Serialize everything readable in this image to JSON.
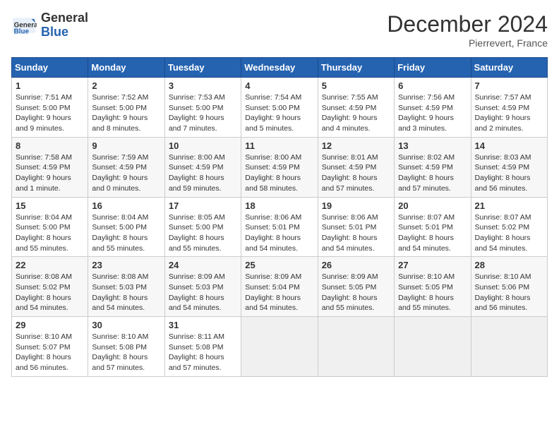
{
  "header": {
    "logo_line1": "General",
    "logo_line2": "Blue",
    "month": "December 2024",
    "location": "Pierrevert, France"
  },
  "weekdays": [
    "Sunday",
    "Monday",
    "Tuesday",
    "Wednesday",
    "Thursday",
    "Friday",
    "Saturday"
  ],
  "weeks": [
    [
      {
        "day": 1,
        "sunrise": "7:51 AM",
        "sunset": "5:00 PM",
        "daylight": "9 hours and 9 minutes."
      },
      {
        "day": 2,
        "sunrise": "7:52 AM",
        "sunset": "5:00 PM",
        "daylight": "9 hours and 8 minutes."
      },
      {
        "day": 3,
        "sunrise": "7:53 AM",
        "sunset": "5:00 PM",
        "daylight": "9 hours and 7 minutes."
      },
      {
        "day": 4,
        "sunrise": "7:54 AM",
        "sunset": "5:00 PM",
        "daylight": "9 hours and 5 minutes."
      },
      {
        "day": 5,
        "sunrise": "7:55 AM",
        "sunset": "4:59 PM",
        "daylight": "9 hours and 4 minutes."
      },
      {
        "day": 6,
        "sunrise": "7:56 AM",
        "sunset": "4:59 PM",
        "daylight": "9 hours and 3 minutes."
      },
      {
        "day": 7,
        "sunrise": "7:57 AM",
        "sunset": "4:59 PM",
        "daylight": "9 hours and 2 minutes."
      }
    ],
    [
      {
        "day": 8,
        "sunrise": "7:58 AM",
        "sunset": "4:59 PM",
        "daylight": "9 hours and 1 minute."
      },
      {
        "day": 9,
        "sunrise": "7:59 AM",
        "sunset": "4:59 PM",
        "daylight": "9 hours and 0 minutes."
      },
      {
        "day": 10,
        "sunrise": "8:00 AM",
        "sunset": "4:59 PM",
        "daylight": "8 hours and 59 minutes."
      },
      {
        "day": 11,
        "sunrise": "8:00 AM",
        "sunset": "4:59 PM",
        "daylight": "8 hours and 58 minutes."
      },
      {
        "day": 12,
        "sunrise": "8:01 AM",
        "sunset": "4:59 PM",
        "daylight": "8 hours and 57 minutes."
      },
      {
        "day": 13,
        "sunrise": "8:02 AM",
        "sunset": "4:59 PM",
        "daylight": "8 hours and 57 minutes."
      },
      {
        "day": 14,
        "sunrise": "8:03 AM",
        "sunset": "4:59 PM",
        "daylight": "8 hours and 56 minutes."
      }
    ],
    [
      {
        "day": 15,
        "sunrise": "8:04 AM",
        "sunset": "5:00 PM",
        "daylight": "8 hours and 55 minutes."
      },
      {
        "day": 16,
        "sunrise": "8:04 AM",
        "sunset": "5:00 PM",
        "daylight": "8 hours and 55 minutes."
      },
      {
        "day": 17,
        "sunrise": "8:05 AM",
        "sunset": "5:00 PM",
        "daylight": "8 hours and 55 minutes."
      },
      {
        "day": 18,
        "sunrise": "8:06 AM",
        "sunset": "5:01 PM",
        "daylight": "8 hours and 54 minutes."
      },
      {
        "day": 19,
        "sunrise": "8:06 AM",
        "sunset": "5:01 PM",
        "daylight": "8 hours and 54 minutes."
      },
      {
        "day": 20,
        "sunrise": "8:07 AM",
        "sunset": "5:01 PM",
        "daylight": "8 hours and 54 minutes."
      },
      {
        "day": 21,
        "sunrise": "8:07 AM",
        "sunset": "5:02 PM",
        "daylight": "8 hours and 54 minutes."
      }
    ],
    [
      {
        "day": 22,
        "sunrise": "8:08 AM",
        "sunset": "5:02 PM",
        "daylight": "8 hours and 54 minutes."
      },
      {
        "day": 23,
        "sunrise": "8:08 AM",
        "sunset": "5:03 PM",
        "daylight": "8 hours and 54 minutes."
      },
      {
        "day": 24,
        "sunrise": "8:09 AM",
        "sunset": "5:03 PM",
        "daylight": "8 hours and 54 minutes."
      },
      {
        "day": 25,
        "sunrise": "8:09 AM",
        "sunset": "5:04 PM",
        "daylight": "8 hours and 54 minutes."
      },
      {
        "day": 26,
        "sunrise": "8:09 AM",
        "sunset": "5:05 PM",
        "daylight": "8 hours and 55 minutes."
      },
      {
        "day": 27,
        "sunrise": "8:10 AM",
        "sunset": "5:05 PM",
        "daylight": "8 hours and 55 minutes."
      },
      {
        "day": 28,
        "sunrise": "8:10 AM",
        "sunset": "5:06 PM",
        "daylight": "8 hours and 56 minutes."
      }
    ],
    [
      {
        "day": 29,
        "sunrise": "8:10 AM",
        "sunset": "5:07 PM",
        "daylight": "8 hours and 56 minutes."
      },
      {
        "day": 30,
        "sunrise": "8:10 AM",
        "sunset": "5:08 PM",
        "daylight": "8 hours and 57 minutes."
      },
      {
        "day": 31,
        "sunrise": "8:11 AM",
        "sunset": "5:08 PM",
        "daylight": "8 hours and 57 minutes."
      },
      null,
      null,
      null,
      null
    ]
  ]
}
